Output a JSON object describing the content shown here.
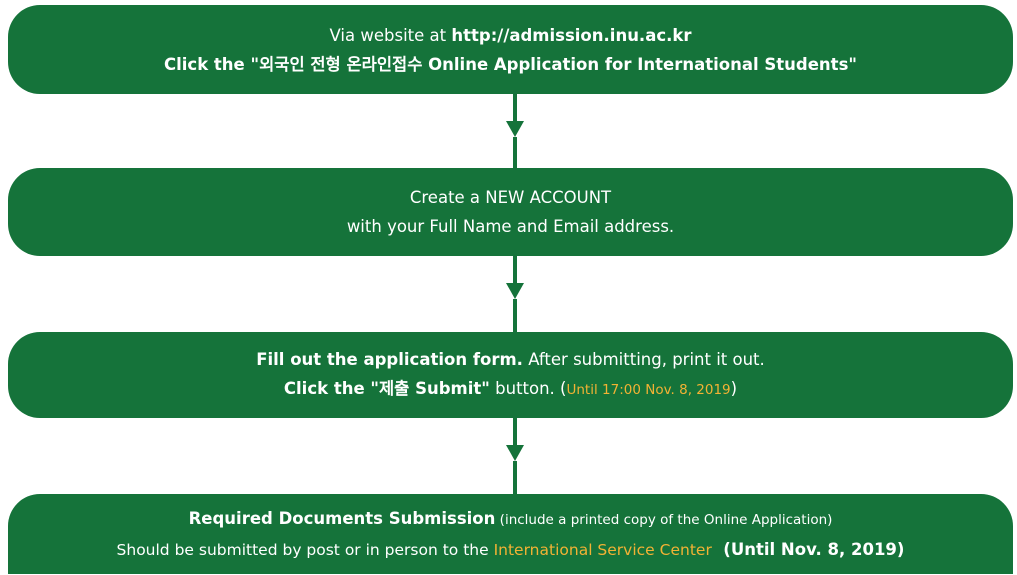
{
  "steps": [
    {
      "line1_pre": "Via website at ",
      "line1_url": "http://admission.inu.ac.kr",
      "line2": "Click the \"외국인 전형 온라인접수 Online Application for International Students\""
    },
    {
      "line1": "Create a NEW ACCOUNT",
      "line2": "with your Full Name and Email address."
    },
    {
      "line1_bold": "Fill out the application form.",
      "line1_rest": " After submitting, print it out.",
      "line2_bold": "Click the \"제출 Submit\"",
      "line2_rest": " button. (",
      "line2_deadline": "Until 17:00 Nov. 8, 2019",
      "line2_close": ")"
    },
    {
      "line1_bold": "Required Documents Submission",
      "line1_rest": " (include a printed copy of the Online Application)",
      "line2_pre": "Should be submitted by post or in person to the ",
      "line2_highlight": "International Service Center",
      "line2_bold": "  (Until Nov. 8, 2019)"
    }
  ],
  "colors": {
    "step_fill": "#15733a",
    "text": "#ffffff",
    "highlight": "#f2b234",
    "background": "#ffffff"
  }
}
